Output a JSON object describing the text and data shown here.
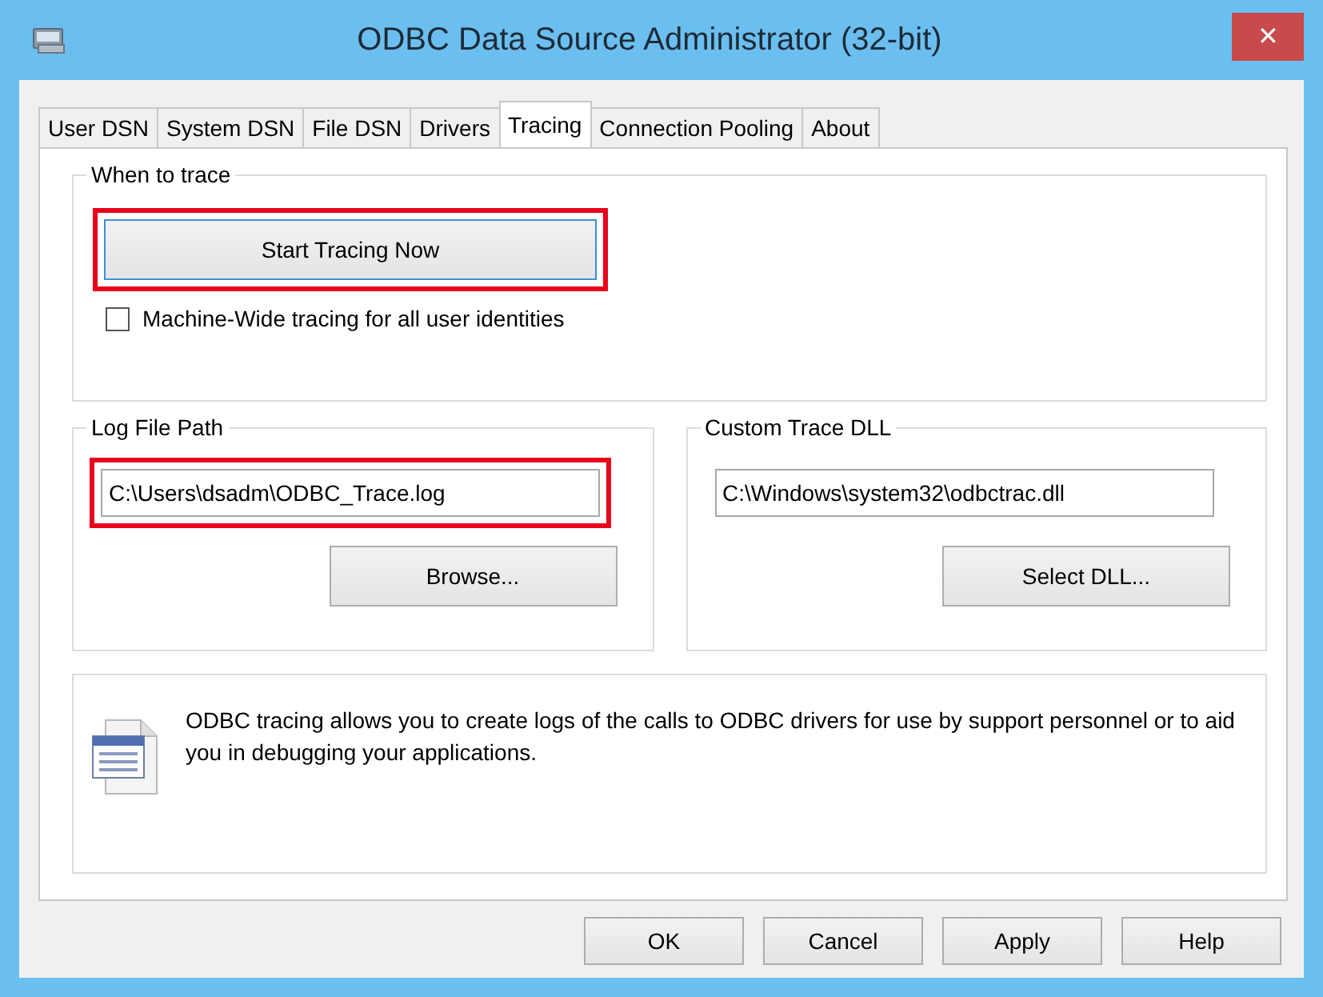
{
  "window": {
    "title": "ODBC Data Source Administrator (32-bit)",
    "close": "✕"
  },
  "tabs": [
    {
      "label": "User DSN",
      "selected": false
    },
    {
      "label": "System DSN",
      "selected": false
    },
    {
      "label": "File DSN",
      "selected": false
    },
    {
      "label": "Drivers",
      "selected": false
    },
    {
      "label": "Tracing",
      "selected": true
    },
    {
      "label": "Connection Pooling",
      "selected": false
    },
    {
      "label": "About",
      "selected": false
    }
  ],
  "when_to_trace": {
    "title": "When to trace",
    "button": {
      "label": "Start Tracing Now",
      "highlighted": true
    },
    "checkbox": {
      "label": "Machine-Wide tracing for all user identities",
      "checked": false
    }
  },
  "log_file_path": {
    "title": "Log File Path",
    "value": "C:\\Users\\dsadm\\ODBC_Trace.log",
    "highlighted": true,
    "button": "Browse..."
  },
  "custom_trace_dll": {
    "title": "Custom Trace DLL",
    "value": "C:\\Windows\\system32\\odbctrac.dll",
    "highlighted": false,
    "button": "Select DLL..."
  },
  "info": {
    "text": "ODBC tracing allows you to create logs of the calls to ODBC drivers for use by support personnel or to aid you in debugging your applications."
  },
  "buttons": [
    "OK",
    "Cancel",
    "Apply",
    "Help"
  ]
}
